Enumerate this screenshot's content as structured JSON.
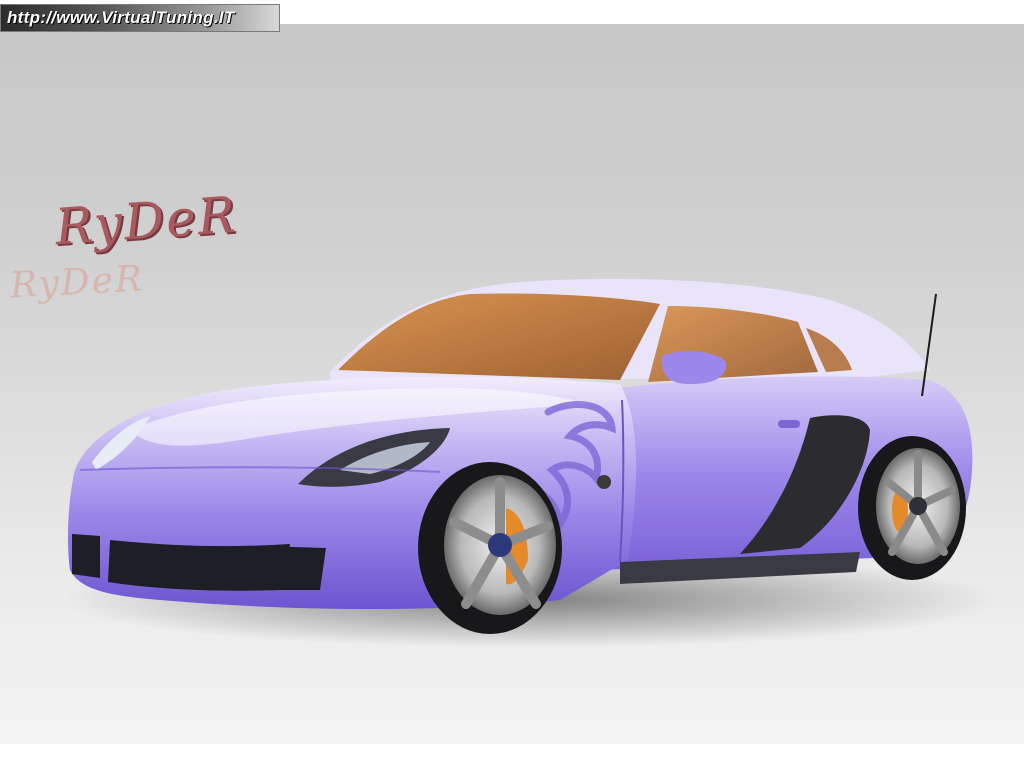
{
  "banner": {
    "url_text": "http://www.VirtualTuning.IT"
  },
  "signature": {
    "text": "RyDeR",
    "ghost_text": "RyDeR"
  },
  "car": {
    "name": "tuned purple coupe",
    "body_color": "#9a86e8",
    "body_highlight": "#e6defa",
    "glass_color": "#c27a3a",
    "brake_color": "#e58a2a"
  },
  "colors": {
    "background_top": "#c7c7c7",
    "background_bottom": "#f4f4f4"
  }
}
